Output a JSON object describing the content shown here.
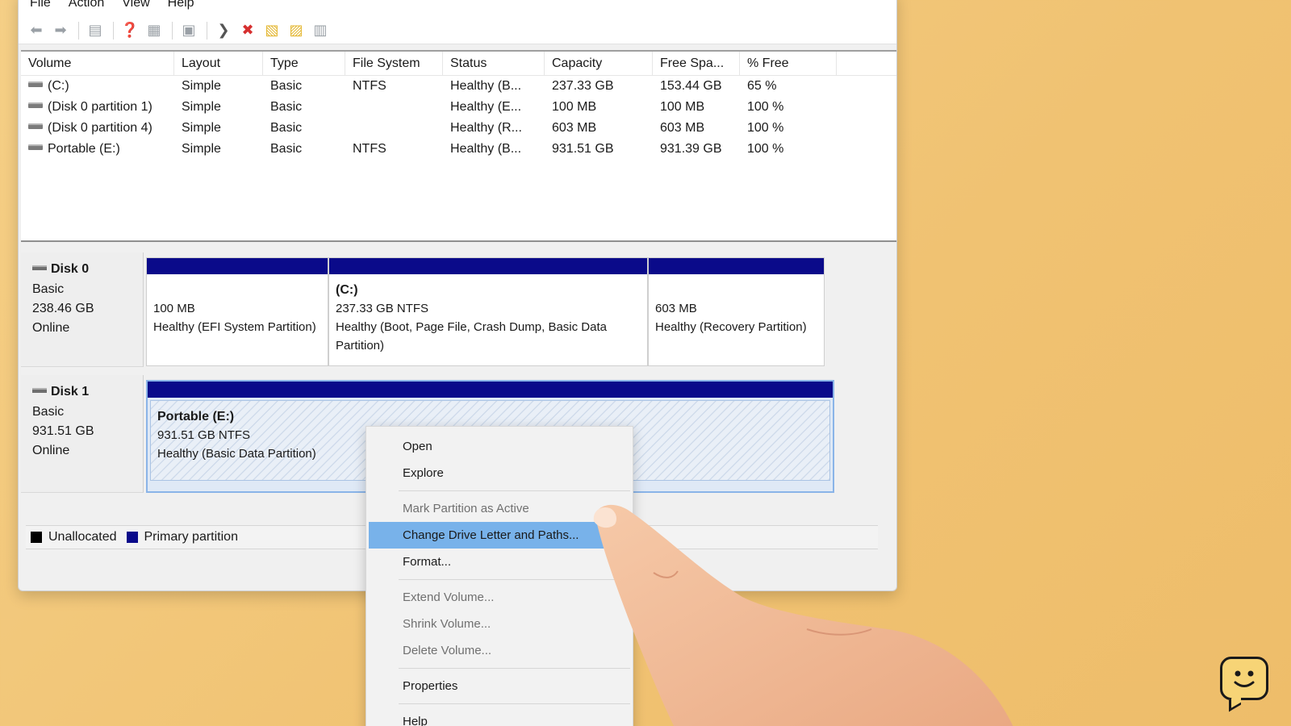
{
  "menubar": {
    "items": [
      "File",
      "Action",
      "View",
      "Help"
    ]
  },
  "toolbar": {
    "buttons": [
      "back-arrow-icon",
      "forward-arrow-icon",
      "console-tree-icon",
      "help-icon",
      "properties-icon",
      "refresh-icon",
      "connect-icon",
      "delete-icon",
      "new-folder-icon",
      "new-folder-alt-icon",
      "settings-icon"
    ]
  },
  "volume_table": {
    "columns": [
      "Volume",
      "Layout",
      "Type",
      "File System",
      "Status",
      "Capacity",
      "Free Spa...",
      "% Free"
    ],
    "rows": [
      [
        "(C:)",
        "Simple",
        "Basic",
        "NTFS",
        "Healthy (B...",
        "237.33 GB",
        "153.44 GB",
        "65 %"
      ],
      [
        "(Disk 0 partition 1)",
        "Simple",
        "Basic",
        "",
        "Healthy (E...",
        "100 MB",
        "100 MB",
        "100 %"
      ],
      [
        "(Disk 0 partition 4)",
        "Simple",
        "Basic",
        "",
        "Healthy (R...",
        "603 MB",
        "603 MB",
        "100 %"
      ],
      [
        "Portable (E:)",
        "Simple",
        "Basic",
        "NTFS",
        "Healthy (B...",
        "931.51 GB",
        "931.39 GB",
        "100 %"
      ]
    ]
  },
  "disks": [
    {
      "name": "Disk 0",
      "type": "Basic",
      "size": "238.46 GB",
      "status": "Online",
      "partitions": [
        {
          "name": "",
          "size": "100 MB",
          "status": "Healthy (EFI System Partition)"
        },
        {
          "name": "(C:)",
          "size": "237.33 GB NTFS",
          "status": "Healthy (Boot, Page File, Crash Dump, Basic Data Partition)"
        },
        {
          "name": "",
          "size": "603 MB",
          "status": "Healthy (Recovery Partition)"
        }
      ]
    },
    {
      "name": "Disk 1",
      "type": "Basic",
      "size": "931.51 GB",
      "status": "Online",
      "partitions": [
        {
          "name": "Portable  (E:)",
          "size": "931.51 GB NTFS",
          "status": "Healthy (Basic Data Partition)"
        }
      ]
    }
  ],
  "legend": {
    "unallocated": "Unallocated",
    "primary": "Primary partition",
    "unallocated_color": "#000000",
    "primary_color": "#0a0a8a"
  },
  "context_menu": {
    "open": "Open",
    "explore": "Explore",
    "mark_active": "Mark Partition as Active",
    "change_letter": "Change Drive Letter and Paths...",
    "format": "Format...",
    "extend": "Extend Volume...",
    "shrink": "Shrink Volume...",
    "delete": "Delete Volume...",
    "properties": "Properties",
    "help": "Help"
  },
  "colors": {
    "background": "#f2c777",
    "partition_bar": "#0a0a8a",
    "menu_highlight": "#78b2ea"
  }
}
